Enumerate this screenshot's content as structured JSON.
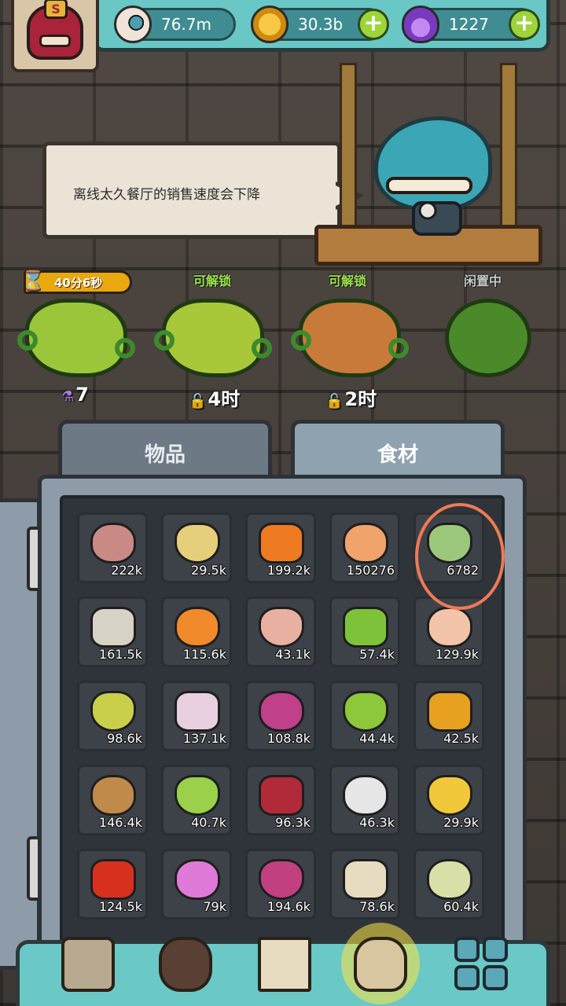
{
  "resources": [
    {
      "name": "eyeball",
      "value": "76.7m",
      "icon": "eyeball-icon",
      "color": "#e9d8cf"
    },
    {
      "name": "coin",
      "value": "30.3b",
      "icon": "coin-icon",
      "color": "#e9a81a"
    },
    {
      "name": "potion",
      "value": "1227",
      "icon": "potion-icon",
      "color": "#9b5ae0"
    }
  ],
  "add_symbol": "+",
  "avatar_badge": "S",
  "speech": "离线太久餐厅的销售速度会下降",
  "plants": [
    {
      "label": "",
      "timer": "40分6秒",
      "value": "7",
      "value_icon": "potion-icon",
      "color": "#9bc63a"
    },
    {
      "label": "可解锁",
      "value": "4时",
      "value_icon": "lock-icon",
      "color": "#a8c83a"
    },
    {
      "label": "可解锁",
      "value": "2时",
      "value_icon": "lock-icon",
      "color": "#c77a3a"
    },
    {
      "label": "闲置中",
      "value": "",
      "value_icon": "",
      "color": "#4a8a2a"
    }
  ],
  "tabs": [
    {
      "label": "物品",
      "active": false
    },
    {
      "label": "食材",
      "active": true
    }
  ],
  "ingredients": [
    {
      "name": "meatballs",
      "count": "222k",
      "color": "#c98a86"
    },
    {
      "name": "roots",
      "count": "29.5k",
      "color": "#e6cf7a"
    },
    {
      "name": "carrot",
      "count": "199.2k",
      "color": "#ee7a22"
    },
    {
      "name": "egg",
      "count": "150276",
      "color": "#f0a36a"
    },
    {
      "name": "leek",
      "count": "6782",
      "color": "#9bc77a"
    },
    {
      "name": "oyster",
      "count": "161.5k",
      "color": "#d7d2c6"
    },
    {
      "name": "mushroom",
      "count": "115.6k",
      "color": "#f08a2a"
    },
    {
      "name": "worms",
      "count": "43.1k",
      "color": "#e8b0a0"
    },
    {
      "name": "peas",
      "count": "57.4k",
      "color": "#7ec23a"
    },
    {
      "name": "drumstick",
      "count": "129.9k",
      "color": "#f3c4aa"
    },
    {
      "name": "avocado",
      "count": "98.6k",
      "color": "#c9cf4a"
    },
    {
      "name": "dragon-fruit",
      "count": "137.1k",
      "color": "#e8d0e0"
    },
    {
      "name": "onion",
      "count": "108.8k",
      "color": "#c0408a"
    },
    {
      "name": "kiwi",
      "count": "44.4k",
      "color": "#8cc83a"
    },
    {
      "name": "pepper",
      "count": "42.5k",
      "color": "#e8a020"
    },
    {
      "name": "mandrake",
      "count": "146.4k",
      "color": "#c08a4a"
    },
    {
      "name": "celery",
      "count": "40.7k",
      "color": "#9ad04a"
    },
    {
      "name": "pomegranate",
      "count": "96.3k",
      "color": "#b02a3a"
    },
    {
      "name": "sugar-cubes",
      "count": "46.3k",
      "color": "#e6e6e6"
    },
    {
      "name": "cheese",
      "count": "29.9k",
      "color": "#f0c83a"
    },
    {
      "name": "tomato",
      "count": "124.5k",
      "color": "#d8301e"
    },
    {
      "name": "pink-egg",
      "count": "79k",
      "color": "#e07ad8"
    },
    {
      "name": "sweet-potato",
      "count": "194.6k",
      "color": "#c04080"
    },
    {
      "name": "tofu",
      "count": "78.6k",
      "color": "#e8dcc0"
    },
    {
      "name": "cabbage",
      "count": "60.4k",
      "color": "#d8e0a8"
    }
  ],
  "nav": [
    {
      "name": "restaurant",
      "icon": "shop-icon",
      "selected": false
    },
    {
      "name": "monster",
      "icon": "monster-icon",
      "selected": false
    },
    {
      "name": "book",
      "icon": "book-icon",
      "selected": false
    },
    {
      "name": "bag",
      "icon": "bag-icon",
      "selected": true
    },
    {
      "name": "menu",
      "icon": "grid-icon",
      "selected": false
    }
  ]
}
